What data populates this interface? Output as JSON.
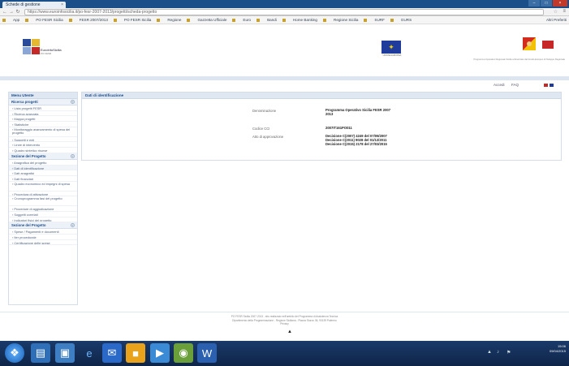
{
  "browser": {
    "tab_title": "Schede di gestione",
    "url": "https://www.euroinfosicilia.it/po-fesr-2007-2013/progetti/scheda-progetto",
    "bookmarks": [
      "App",
      "PO FESR Sicilia",
      "FESR 2007/2013",
      "PO FESR Sicilia",
      "Regione",
      "Gazzetta Ufficiale",
      "Euro",
      "Bandi",
      "Home Banking",
      "Regione Sicilia",
      "SURF",
      "GURS"
    ],
    "other_bookmarks": "Altri Preferiti"
  },
  "header": {
    "logo_title": "EuroInfoSicilia",
    "logo_subtitle": "PO FESR",
    "eu_caption": "UNIONE EUROPEA",
    "description": "Programma Operativo Regionale Sicilia cofinanziato dal Fondo Europeo di Sviluppo Regionale"
  },
  "utility": {
    "links": [
      "Accedi",
      "FAQ"
    ]
  },
  "sidebar": {
    "title": "Menu Utente",
    "sections": [
      {
        "label": "Ricerca progetti",
        "toggle": "+",
        "items": [
          {
            "label": "Lista progetti FESR",
            "two": false
          },
          {
            "label": "Ricerca avanzata",
            "two": false
          },
          {
            "label": "Mappa progetti",
            "two": false
          },
          {
            "label": "Statistiche",
            "two": false
          },
          {
            "label": "Monitoraggio avanzamento di spesa del progetto",
            "two": true
          },
          {
            "label": "Soggetti e enti",
            "two": false
          },
          {
            "label": "Linee di intervento",
            "two": false
          },
          {
            "label": "Quadro sintetico risorse",
            "two": false
          }
        ]
      },
      {
        "label": "Sezione del Progetto",
        "toggle": "+",
        "items": [
          {
            "label": "Anagrafica del progetto",
            "two": false
          },
          {
            "label": "Dati di identificazione",
            "two": false,
            "active": true
          },
          {
            "label": "Dati anagrafici",
            "two": false
          },
          {
            "label": "Dati finanziari",
            "two": false
          },
          {
            "label": "Quadro economico ed impegni di spesa",
            "two": true
          },
          {
            "label": "Procedura di attivazione",
            "two": false
          },
          {
            "label": "Cronoprogramma fasi del progetto",
            "two": true
          },
          {
            "label": "Procedure di aggiudicazione",
            "two": false
          },
          {
            "label": "Soggetti correlati",
            "two": false
          },
          {
            "label": "Indicatori fisici del progetto",
            "two": false
          }
        ]
      },
      {
        "label": "Sezione del Progetto",
        "toggle": "+",
        "items": [
          {
            "label": "Spese / Pagamenti e documenti",
            "two": false
          },
          {
            "label": "Iter procedurale",
            "two": false
          },
          {
            "label": "Certificazione delle spese",
            "two": false
          }
        ]
      }
    ]
  },
  "main": {
    "title": "Dati di identificazione",
    "rows": [
      {
        "label": "Denominazione",
        "value_lines": [
          "Programma Operativo Sicilia FESR 2007",
          "2013"
        ]
      },
      {
        "label": "Codice CCI",
        "value_lines": [
          "2007IT161PO011"
        ]
      },
      {
        "label": "Atto di approvazione",
        "value_lines": [
          "Decisione C(2007) 4249 del 07/09/2007",
          "Decisione C(2011) 9028 del 01/12/2011",
          "Decisione C(2015) 2178 del 27/03/2015"
        ]
      }
    ]
  },
  "footer": {
    "lines": [
      "PO FESR Sicilia 2007-2013 - sito realizzato nell'ambito del Programma di Assistenza Tecnica",
      "Dipartimento della Programmazione - Regione Siciliana - Piazza Sturzo 36, 90139 Palermo",
      "Privacy"
    ]
  },
  "taskbar": {
    "apps": [
      "start",
      "explorer",
      "folder",
      "ie",
      "mail",
      "chrome",
      "media",
      "photo",
      "word"
    ],
    "time": "15:06",
    "date": "09/04/2015"
  },
  "colors": {
    "accent": "#1f4e8c",
    "panel_header": "#dfe8f2",
    "taskbar": "#1a3a6a"
  }
}
